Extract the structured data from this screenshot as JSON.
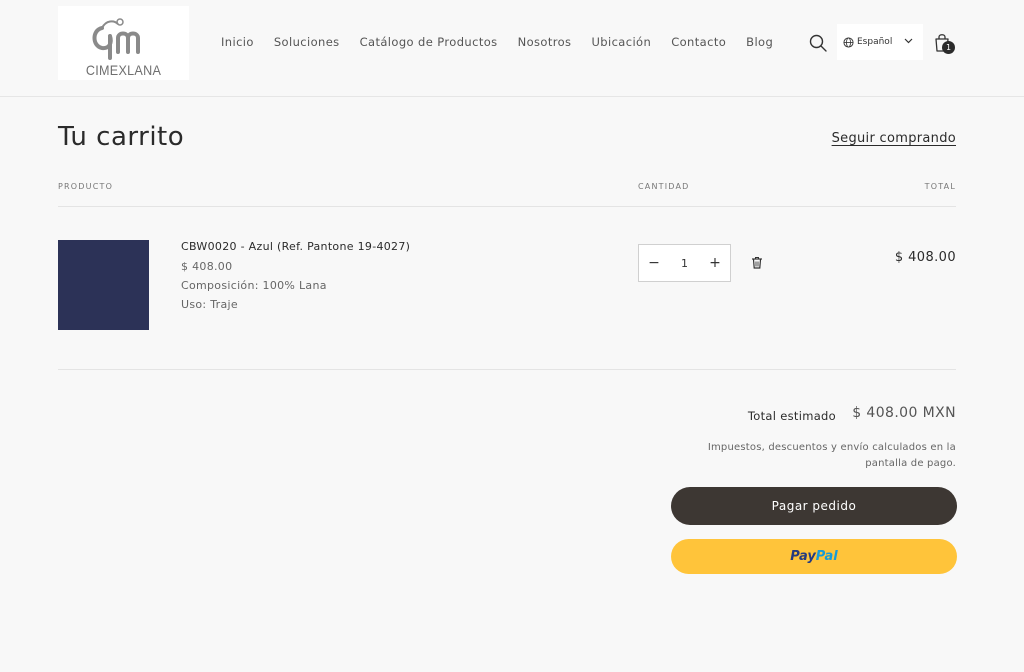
{
  "header": {
    "logo_text": "CIMEXLANA",
    "nav": [
      "Inicio",
      "Soluciones",
      "Catálogo de Productos",
      "Nosotros",
      "Ubicación",
      "Contacto",
      "Blog"
    ],
    "language": "Español",
    "cart_count": "1"
  },
  "cart": {
    "title": "Tu carrito",
    "continue_link": "Seguir comprando",
    "columns": {
      "product": "PRODUCTO",
      "quantity": "CANTIDAD",
      "total": "TOTAL"
    },
    "items": [
      {
        "name": "CBW0020 - Azul (Ref. Pantone 19-4027)",
        "price": "$ 408.00",
        "composition": "Composición: 100% Lana",
        "use": "Uso: Traje",
        "quantity": "1",
        "line_total": "$ 408.00",
        "swatch_color": "#2c3257"
      }
    ],
    "total_label": "Total estimado",
    "total_value": "$ 408.00 MXN",
    "tax_note": "Impuestos, descuentos y envío calculados en la pantalla de pago.",
    "checkout_label": "Pagar pedido",
    "paypal_label_1": "Pay",
    "paypal_label_2": "Pal"
  },
  "colors": {
    "checkout_button": "#3d3733",
    "paypal_button": "#ffc43a"
  }
}
